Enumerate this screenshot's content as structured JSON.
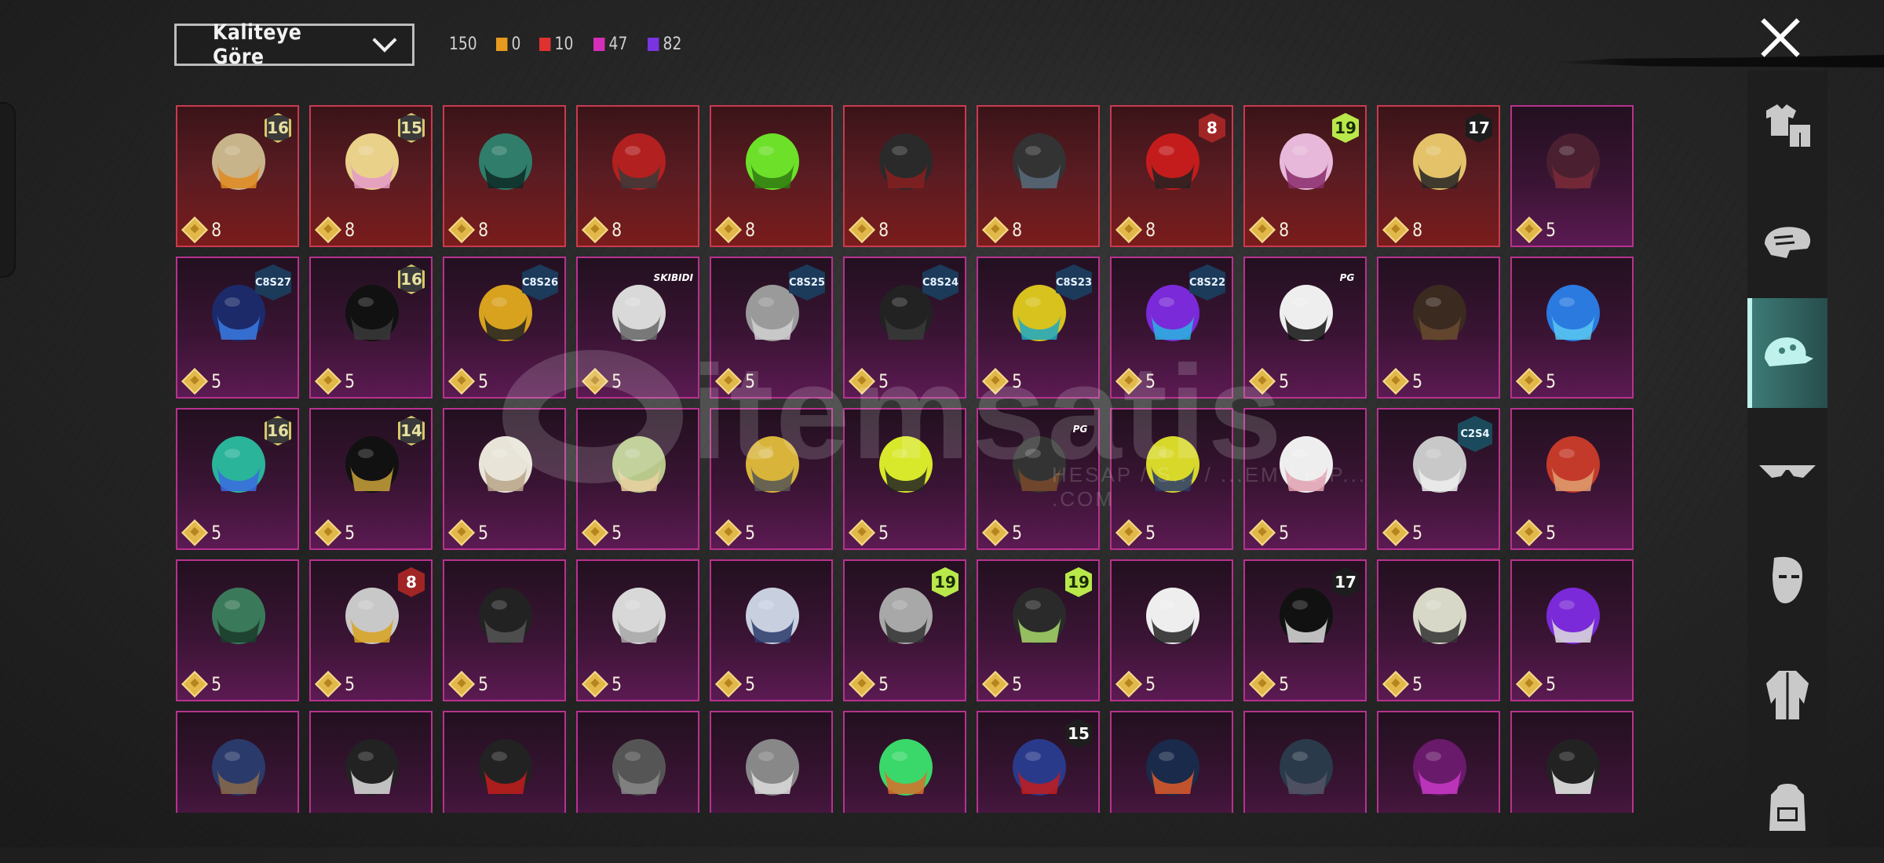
{
  "sort": {
    "label": "Kaliteye Göre"
  },
  "stats": {
    "total": "150",
    "counts": [
      {
        "color": "#e69a1e",
        "value": "0"
      },
      {
        "color": "#e03131",
        "value": "10"
      },
      {
        "color": "#d42fb8",
        "value": "47"
      },
      {
        "color": "#7a34e0",
        "value": "82"
      }
    ]
  },
  "watermark": {
    "text": "itemsatis",
    "sub": "HESAP / S... / ...EM / E-P... .COM"
  },
  "sidebar": {
    "items": [
      "outfit-icon",
      "helmet-icon",
      "cap-icon",
      "glasses-icon",
      "mask-icon",
      "jacket-icon",
      "backpack-icon"
    ],
    "active": 2
  },
  "items": [
    {
      "q": "red",
      "price": "8",
      "badge": "16",
      "bt": "lvl",
      "art": "goggle-hat"
    },
    {
      "q": "red",
      "price": "8",
      "badge": "15",
      "bt": "lvl",
      "art": "blonde-hair"
    },
    {
      "q": "red",
      "price": "8",
      "badge": "",
      "bt": "",
      "art": "spike-helmet"
    },
    {
      "q": "red",
      "price": "8",
      "badge": "",
      "bt": "",
      "art": "red-helmet"
    },
    {
      "q": "red",
      "price": "8",
      "badge": "",
      "bt": "",
      "art": "green-crest"
    },
    {
      "q": "red",
      "price": "8",
      "badge": "",
      "bt": "",
      "art": "dark-helmet"
    },
    {
      "q": "red",
      "price": "8",
      "badge": "",
      "bt": "",
      "art": "cap-mask"
    },
    {
      "q": "red",
      "price": "8",
      "badge": "8",
      "bt": "red",
      "art": "red-hat"
    },
    {
      "q": "red",
      "price": "8",
      "badge": "19",
      "bt": "lime",
      "art": "pink-mask"
    },
    {
      "q": "red",
      "price": "8",
      "badge": "17",
      "bt": "dark",
      "art": "gold-helmet"
    },
    {
      "q": "purple",
      "price": "5",
      "badge": "",
      "bt": "",
      "art": "dark-hair"
    },
    {
      "q": "purple",
      "price": "5",
      "badge": "C8S27",
      "bt": "blue",
      "art": "bunny-headset"
    },
    {
      "q": "purple",
      "price": "5",
      "badge": "16",
      "bt": "lvl",
      "art": "black-mask"
    },
    {
      "q": "purple",
      "price": "5",
      "badge": "C8S26",
      "bt": "blue",
      "art": "bee-helmet"
    },
    {
      "q": "purple",
      "price": "5",
      "badge": "SKIBIDI",
      "bt": "text",
      "art": "camera-head"
    },
    {
      "q": "purple",
      "price": "5",
      "badge": "C8S25",
      "bt": "blue",
      "art": "grey-hair"
    },
    {
      "q": "purple",
      "price": "5",
      "badge": "C8S24",
      "bt": "blue",
      "art": "black-hair"
    },
    {
      "q": "purple",
      "price": "5",
      "badge": "C8S23",
      "bt": "blue",
      "art": "cat-headset"
    },
    {
      "q": "purple",
      "price": "5",
      "badge": "C8S22",
      "bt": "blue",
      "art": "neon-hair"
    },
    {
      "q": "purple",
      "price": "5",
      "badge": "PG",
      "bt": "text",
      "art": "panda-head"
    },
    {
      "q": "purple",
      "price": "5",
      "badge": "",
      "bt": "",
      "art": "feather"
    },
    {
      "q": "purple",
      "price": "5",
      "badge": "",
      "bt": "",
      "art": "blue-dragon"
    },
    {
      "q": "purple",
      "price": "5",
      "badge": "16",
      "bt": "lvl",
      "art": "teal-hair"
    },
    {
      "q": "purple",
      "price": "5",
      "badge": "14",
      "bt": "lvl",
      "art": "gold-band"
    },
    {
      "q": "purple",
      "price": "5",
      "badge": "",
      "bt": "",
      "art": "white-bird"
    },
    {
      "q": "purple",
      "price": "5",
      "badge": "",
      "bt": "",
      "art": "dino-hat"
    },
    {
      "q": "purple",
      "price": "5",
      "badge": "",
      "bt": "",
      "art": "gold-crown"
    },
    {
      "q": "purple",
      "price": "5",
      "badge": "",
      "bt": "",
      "art": "yellow-bucket"
    },
    {
      "q": "purple",
      "price": "5",
      "badge": "PG",
      "bt": "text",
      "art": "gas-mask"
    },
    {
      "q": "purple",
      "price": "5",
      "badge": "",
      "bt": "",
      "art": "yellow-helmet"
    },
    {
      "q": "purple",
      "price": "5",
      "badge": "",
      "bt": "",
      "art": "rabbit-hood"
    },
    {
      "q": "purple",
      "price": "5",
      "badge": "C2S4",
      "bt": "teal",
      "art": "silver-hair"
    },
    {
      "q": "purple",
      "price": "5",
      "badge": "",
      "bt": "",
      "art": "red-gasmask"
    },
    {
      "q": "purple",
      "price": "5",
      "badge": "",
      "bt": "",
      "art": "green-helmet"
    },
    {
      "q": "purple",
      "price": "5",
      "badge": "8",
      "bt": "red",
      "art": "bucket-robot"
    },
    {
      "q": "purple",
      "price": "5",
      "badge": "",
      "bt": "",
      "art": "kendo-mask"
    },
    {
      "q": "purple",
      "price": "5",
      "badge": "",
      "bt": "",
      "art": "white-hair"
    },
    {
      "q": "purple",
      "price": "5",
      "badge": "",
      "bt": "",
      "art": "wolf-helmet"
    },
    {
      "q": "purple",
      "price": "5",
      "badge": "19",
      "bt": "lime",
      "art": "grey-headset"
    },
    {
      "q": "purple",
      "price": "5",
      "badge": "19",
      "bt": "lime",
      "art": "goggle-ball"
    },
    {
      "q": "purple",
      "price": "5",
      "badge": "",
      "bt": "",
      "art": "white-box"
    },
    {
      "q": "purple",
      "price": "5",
      "badge": "17",
      "bt": "dark",
      "art": "black-bell"
    },
    {
      "q": "purple",
      "price": "5",
      "badge": "",
      "bt": "",
      "art": "dreadlocks"
    },
    {
      "q": "purple",
      "price": "5",
      "badge": "",
      "bt": "",
      "art": "punk-mask"
    },
    {
      "q": "purple",
      "price": "",
      "badge": "",
      "bt": "",
      "art": "witch-hat"
    },
    {
      "q": "purple",
      "price": "",
      "badge": "",
      "bt": "",
      "art": "bow-head"
    },
    {
      "q": "purple",
      "price": "",
      "badge": "",
      "bt": "",
      "art": "feather-hat"
    },
    {
      "q": "purple",
      "price": "",
      "badge": "",
      "bt": "",
      "art": "wolf-mask"
    },
    {
      "q": "purple",
      "price": "",
      "badge": "",
      "bt": "",
      "art": "skull-hair"
    },
    {
      "q": "purple",
      "price": "",
      "badge": "",
      "bt": "",
      "art": "frog-hat"
    },
    {
      "q": "purple",
      "price": "",
      "badge": "15",
      "bt": "dark",
      "art": "blue-helmet"
    },
    {
      "q": "purple",
      "price": "",
      "badge": "",
      "bt": "",
      "art": "visor-helmet"
    },
    {
      "q": "purple",
      "price": "",
      "badge": "",
      "bt": "",
      "art": "riot-helmet"
    },
    {
      "q": "purple",
      "price": "",
      "badge": "",
      "bt": "",
      "art": "purple-scarf"
    },
    {
      "q": "purple",
      "price": "",
      "badge": "",
      "bt": "",
      "art": "beanie"
    }
  ]
}
